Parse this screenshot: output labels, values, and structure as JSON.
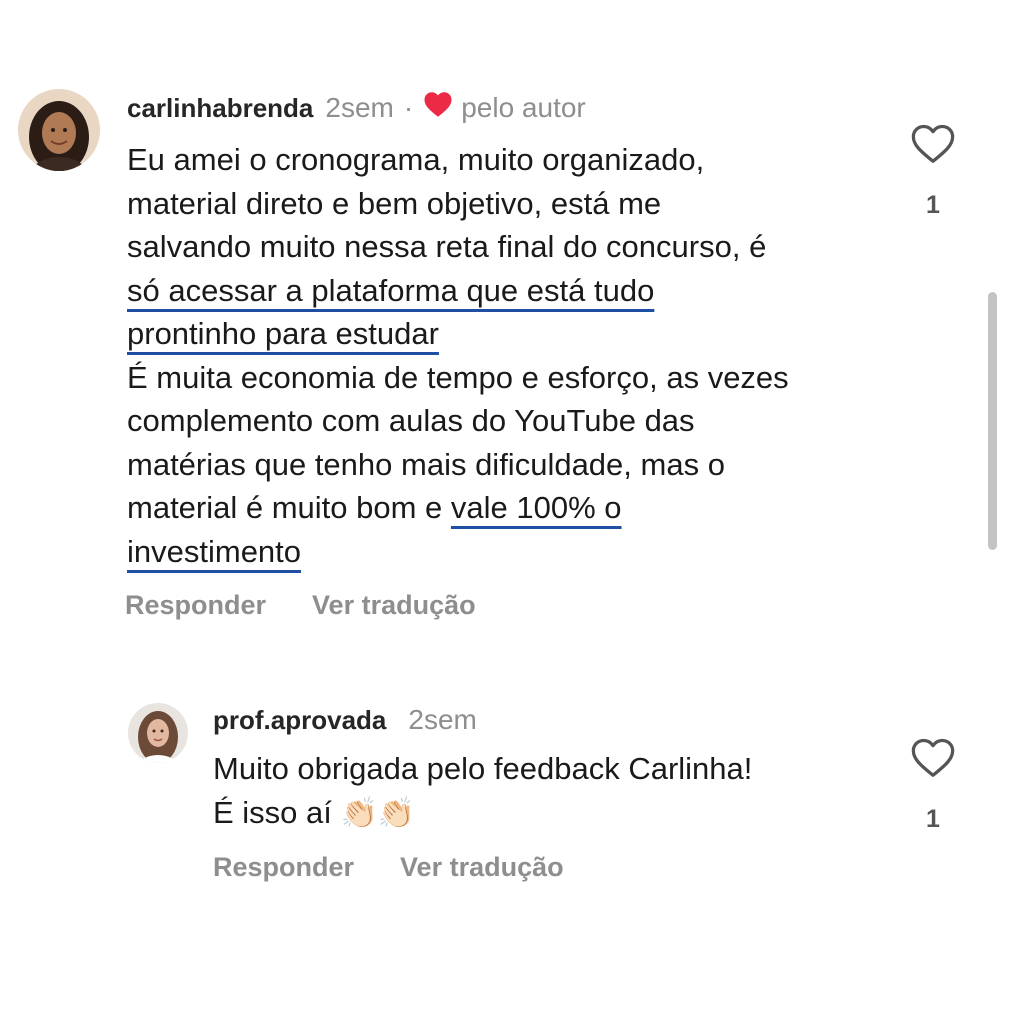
{
  "comments": [
    {
      "username": "carlinhabrenda",
      "time": "2sem",
      "separator": "·",
      "liked_by_author": "pelo autor",
      "likes": "1",
      "lines": [
        "Eu amei o cronograma, muito organizado,",
        "material direto e bem objetivo, está me",
        "salvando muito nessa reta final do concurso, é",
        "só acessar a plataforma que está tudo",
        "prontinho para estudar",
        "É muita economia de tempo e esforço, as vezes",
        "complemento com aulas do YouTube das",
        "matérias que tenho mais dificuldade, mas o",
        "material é muito bom e ",
        "vale 100% o",
        "investimento"
      ],
      "actions": {
        "reply": "Responder",
        "translate": "Ver tradução"
      }
    },
    {
      "username": "prof.aprovada",
      "time": "2sem",
      "likes": "1",
      "lines": [
        "Muito obrigada pelo feedback Carlinha!",
        "É isso aí",
        "👏🏻👏🏻"
      ],
      "actions": {
        "reply": "Responder",
        "translate": "Ver tradução"
      }
    }
  ],
  "icons": {
    "like": "heart-outline-icon",
    "author_like": "heart-filled-icon"
  },
  "colors": {
    "author_heart": "#ed2a46",
    "underline": "#1f4fa3",
    "muted_text": "#8e8e8e"
  }
}
